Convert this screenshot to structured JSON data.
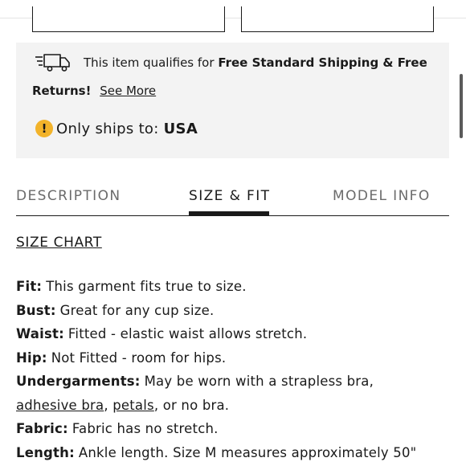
{
  "shipping": {
    "text_prefix": "This item qualifies for",
    "text_bold": "Free Standard Shipping & Free",
    "text_bold_2": "Returns!",
    "see_more": "See More",
    "ships_prefix": "Only ships to:",
    "ships_country": "USA"
  },
  "tabs": [
    {
      "label": "DESCRIPTION",
      "active": false
    },
    {
      "label": "SIZE & FIT",
      "active": true
    },
    {
      "label": "MODEL INFO",
      "active": false
    }
  ],
  "size_chart_label": "SIZE CHART",
  "specs": {
    "fit": {
      "label": "Fit:",
      "value": "This garment fits true to size."
    },
    "bust": {
      "label": "Bust:",
      "value": "Great for any cup size."
    },
    "waist": {
      "label": "Waist:",
      "value": "Fitted - elastic waist allows stretch."
    },
    "hip": {
      "label": "Hip:",
      "value": "Not Fitted - room for hips."
    },
    "undergarments": {
      "label": "Undergarments:",
      "value": "May be worn with a strapless bra,",
      "link1": "adhesive bra",
      "sep": ",",
      "link2": "petals",
      "tail": ", or no bra."
    },
    "fabric": {
      "label": "Fabric:",
      "value": "Fabric has no stretch."
    },
    "length": {
      "label": "Length:",
      "value": "Ankle length. Size M measures approximately 50\""
    }
  },
  "icons": {
    "shipping": "truck-icon",
    "warning": "exclamation-icon"
  },
  "colors": {
    "panel": "#f3f3f3",
    "warning": "#f2b32a",
    "text": "#1a1a1a",
    "muted": "#6b6b6b"
  }
}
